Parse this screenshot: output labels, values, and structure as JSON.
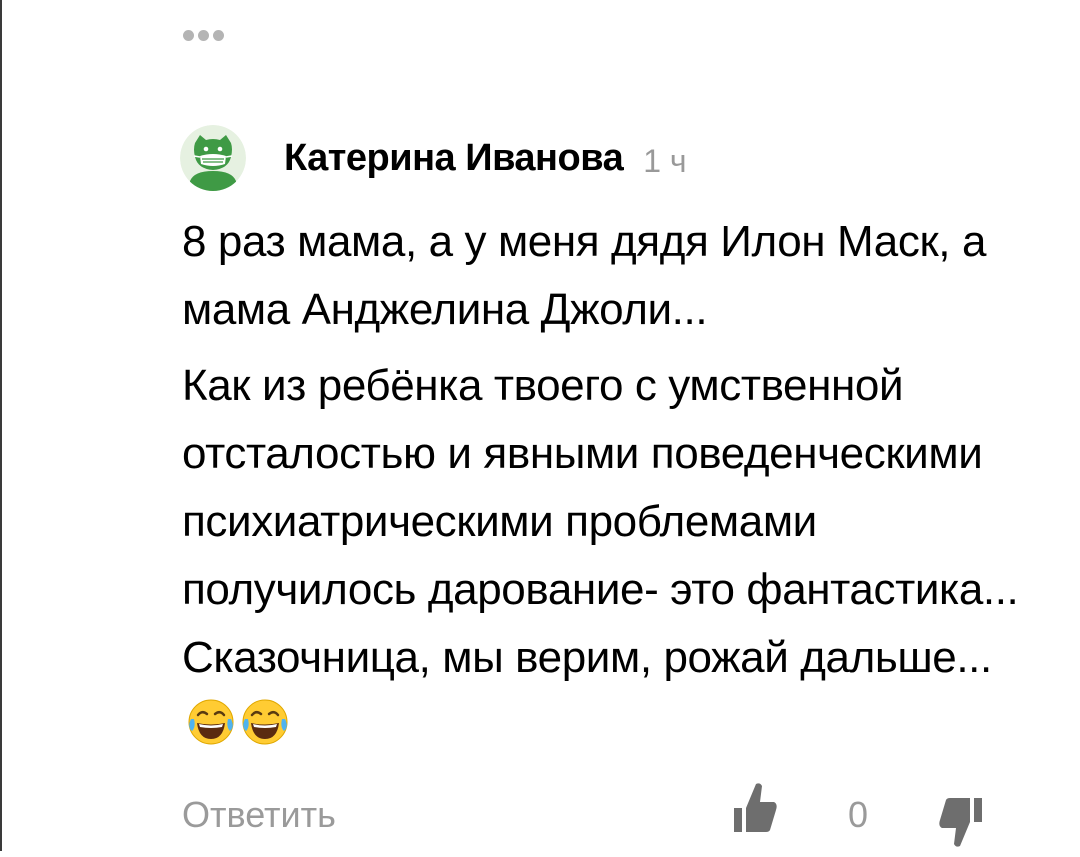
{
  "comment": {
    "author": "Катерина Иванова",
    "time": "1 ч",
    "paragraphs": [
      "8 раз мама, а у меня дядя Илон Маск, а мама Анджелина Джоли...",
      "Как из ребёнка твоего с умственной отсталостью и явными поведенческими психиатрическими проблемами получилось дарование- это фантастика... Сказочница, мы верим, рожай дальше..."
    ],
    "emojis": [
      "face-with-tears-of-joy-icon",
      "face-with-tears-of-joy-icon"
    ]
  },
  "actions": {
    "reply_label": "Ответить",
    "like_count": "0"
  },
  "colors": {
    "avatar_bg": "#e6f1e1",
    "avatar_green": "#3f9a45",
    "muted_text": "#9a9a9a",
    "action_icon": "#6e6e6e"
  }
}
